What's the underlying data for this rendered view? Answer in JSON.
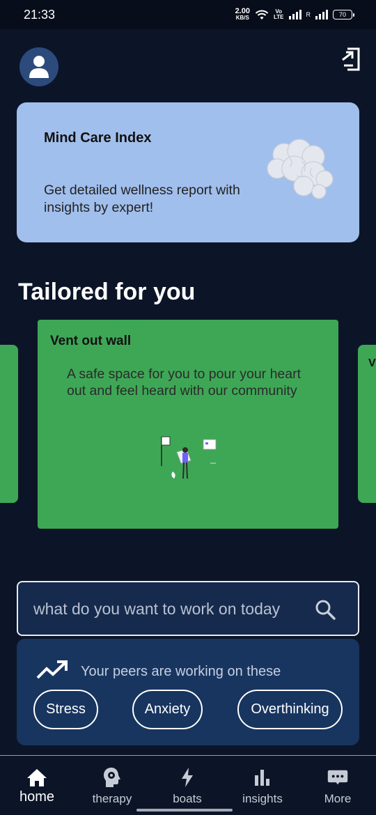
{
  "status_bar": {
    "time": "21:33",
    "speed_value": "2.00",
    "speed_unit": "KB/S",
    "volte_top": "Vo",
    "volte_bottom": "LTE",
    "roaming": "R",
    "battery": "70"
  },
  "mind_card": {
    "title": "Mind Care Index",
    "description": "Get detailed wellness report with insights by expert!"
  },
  "tailored": {
    "title": "Tailored for you",
    "next_card_peek": "V",
    "card": {
      "title": "Vent out wall",
      "description": "A safe space for you to pour your heart out and feel heard with our community"
    }
  },
  "search": {
    "placeholder": "what do you want to work on today"
  },
  "peers": {
    "heading": "Your peers are working on these",
    "chips": [
      "Stress",
      "Anxiety",
      "Overthinking"
    ]
  },
  "nav": {
    "items": [
      {
        "label": "home",
        "icon": "home-icon"
      },
      {
        "label": "therapy",
        "icon": "head-gear-icon"
      },
      {
        "label": "boats",
        "icon": "lightning-icon"
      },
      {
        "label": "insights",
        "icon": "bar-chart-icon"
      },
      {
        "label": "More",
        "icon": "more-dots-icon"
      }
    ]
  },
  "colors": {
    "background": "#0c1527",
    "mind_card": "#a1bfec",
    "vent_card": "#3ea756",
    "peers_card": "#183560",
    "avatar": "#2c4a7c"
  }
}
